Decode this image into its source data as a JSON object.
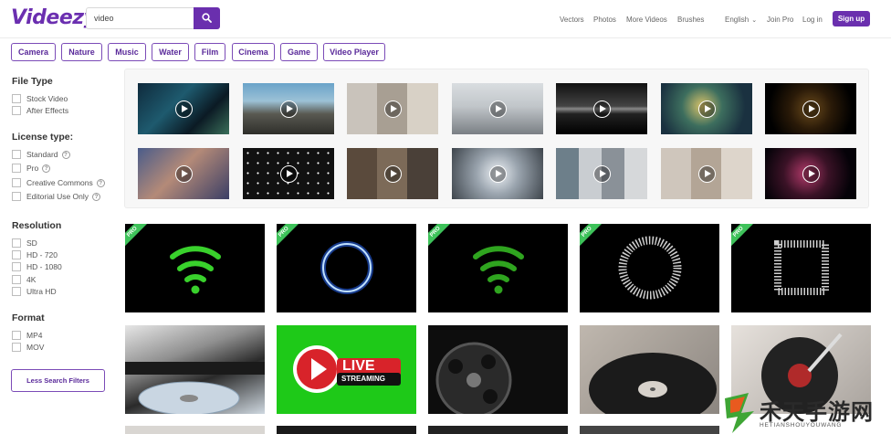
{
  "header": {
    "logo": "Videezy",
    "search_value": "video",
    "nav": [
      "Vectors",
      "Photos",
      "More Videos",
      "Brushes"
    ],
    "language": "English",
    "join_pro": "Join Pro",
    "login": "Log in",
    "signup": "Sign up"
  },
  "tags": [
    "Camera",
    "Nature",
    "Music",
    "Water",
    "Film",
    "Cinema",
    "Game",
    "Video Player"
  ],
  "sidebar": {
    "file_type": {
      "title": "File Type",
      "options": [
        "Stock Video",
        "After Effects"
      ]
    },
    "license": {
      "title": "License type:",
      "options": [
        "Standard",
        "Pro",
        "Creative Commons",
        "Editorial Use Only"
      ]
    },
    "resolution": {
      "title": "Resolution",
      "options": [
        "SD",
        "HD - 720",
        "HD - 1080",
        "4K",
        "Ultra HD"
      ]
    },
    "format": {
      "title": "Format",
      "options": [
        "MP4",
        "MOV"
      ]
    },
    "less_button": "Less Search Filters",
    "info_symbol": "?"
  },
  "grid": {
    "badge": "PRO",
    "live_title": "LIVE",
    "live_sub": "STREAMING"
  },
  "watermark": {
    "title": "禾天手游网",
    "url": "HETIANSHOUYOUWANG"
  },
  "colors": {
    "brand": "#6a2fae",
    "pro_badge": "#3ec25a",
    "wifi_green": "#39d12c"
  }
}
